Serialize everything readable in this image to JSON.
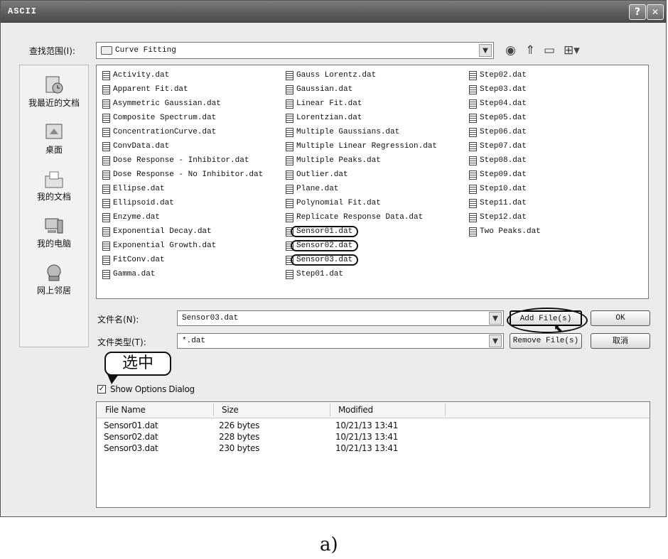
{
  "window": {
    "title": "ASCII",
    "help_btn": "?",
    "close_btn": "✕"
  },
  "lookin": {
    "label": "查找范围(I):",
    "value": "Curve Fitting"
  },
  "places": [
    {
      "label": "我最近的文档",
      "icon": "recent-docs-icon"
    },
    {
      "label": "桌面",
      "icon": "desktop-icon"
    },
    {
      "label": "我的文档",
      "icon": "my-documents-icon"
    },
    {
      "label": "我的电脑",
      "icon": "my-computer-icon"
    },
    {
      "label": "网上邻居",
      "icon": "network-icon"
    }
  ],
  "files": {
    "col1": [
      "Activity.dat",
      "Apparent Fit.dat",
      "Asymmetric Gaussian.dat",
      "Composite Spectrum.dat",
      "ConcentrationCurve.dat",
      "ConvData.dat",
      "Dose Response - Inhibitor.dat",
      "Dose Response - No Inhibitor.dat",
      "Ellipse.dat",
      "Ellipsoid.dat",
      "Enzyme.dat",
      "Exponential Decay.dat",
      "Exponential Growth.dat",
      "FitConv.dat",
      "Gamma.dat"
    ],
    "col2": [
      "Gauss Lorentz.dat",
      "Gaussian.dat",
      "Linear Fit.dat",
      "Lorentzian.dat",
      "Multiple Gaussians.dat",
      "Multiple Linear Regression.dat",
      "Multiple Peaks.dat",
      "Outlier.dat",
      "Plane.dat",
      "Polynomial Fit.dat",
      "Replicate Response Data.dat",
      "Sensor01.dat",
      "Sensor02.dat",
      "Sensor03.dat",
      "Step01.dat"
    ],
    "col3": [
      "Step02.dat",
      "Step03.dat",
      "Step04.dat",
      "Step05.dat",
      "Step06.dat",
      "Step07.dat",
      "Step08.dat",
      "Step09.dat",
      "Step10.dat",
      "Step11.dat",
      "Step12.dat",
      "Two Peaks.dat"
    ]
  },
  "filename": {
    "label": "文件名(N):",
    "value": "Sensor03.dat"
  },
  "filetype": {
    "label": "文件类型(T):",
    "value": "*.dat"
  },
  "buttons": {
    "add": "Add File(s)",
    "remove": "Remove File(s)",
    "ok": "OK",
    "cancel": "取消"
  },
  "callout": "选中",
  "options": {
    "checked": "✓",
    "label": "Show Options Dialog"
  },
  "selected": {
    "headers": [
      "File Name",
      "Size",
      "Modified"
    ],
    "rows": [
      [
        "Sensor01.dat",
        "226 bytes",
        "10/21/13 13:41"
      ],
      [
        "Sensor02.dat",
        "228 bytes",
        "10/21/13 13:41"
      ],
      [
        "Sensor03.dat",
        "230 bytes",
        "10/21/13 13:41"
      ]
    ]
  },
  "caption": "a)"
}
